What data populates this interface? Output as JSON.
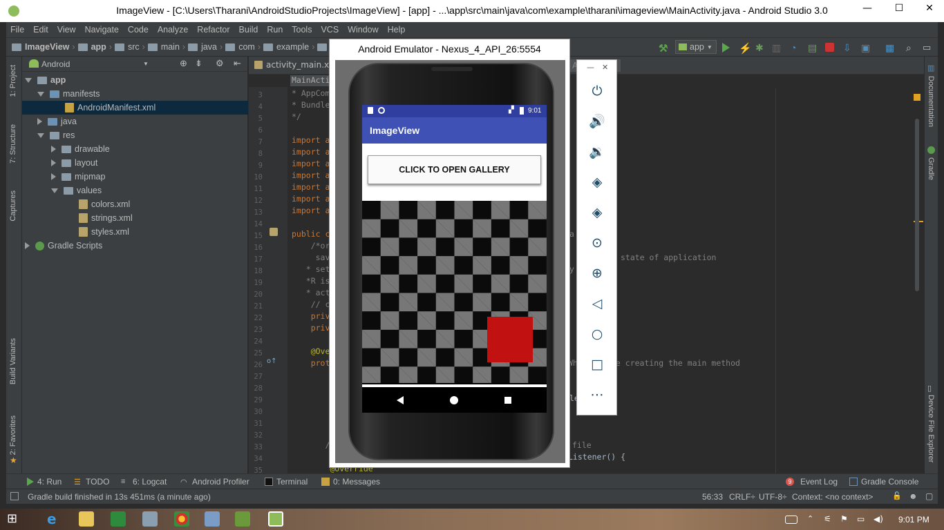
{
  "window": {
    "title": "ImageView - [C:\\Users\\Tharani\\AndroidStudioProjects\\ImageView] - [app] - ...\\app\\src\\main\\java\\com\\example\\tharani\\imageview\\MainActivity.java - Android Studio 3.0",
    "minimize": "—",
    "maximize": "☐",
    "close": "✕"
  },
  "menu": [
    "File",
    "Edit",
    "View",
    "Navigate",
    "Code",
    "Analyze",
    "Refactor",
    "Build",
    "Run",
    "Tools",
    "VCS",
    "Window",
    "Help"
  ],
  "breadcrumb": [
    "ImageView",
    "app",
    "src",
    "main",
    "java",
    "com",
    "example"
  ],
  "toolbar": {
    "config": "app"
  },
  "project": {
    "view": "Android",
    "tree": [
      {
        "label": "app",
        "bold": true
      },
      {
        "label": "manifests"
      },
      {
        "label": "AndroidManifest.xml"
      },
      {
        "label": "java"
      },
      {
        "label": "res"
      },
      {
        "label": "drawable"
      },
      {
        "label": "layout"
      },
      {
        "label": "mipmap"
      },
      {
        "label": "values"
      },
      {
        "label": "colors.xml"
      },
      {
        "label": "strings.xml"
      },
      {
        "label": "styles.xml"
      },
      {
        "label": "Gradle Scripts"
      }
    ]
  },
  "left_tools": [
    "1: Project",
    "7: Structure",
    "Captures",
    "Build Variants",
    "2: Favorites"
  ],
  "right_tools": [
    "Documentation",
    "Gradle",
    "Device File Explorer"
  ],
  "editor": {
    "tabs": [
      "activity_main.xml"
    ],
    "breadcrumb_chip": "MainActi",
    "lines": [
      "3",
      "4",
      "5",
      "6",
      "7",
      "8",
      "9",
      "10",
      "11",
      "12",
      "13",
      "14",
      "15",
      "16",
      "17",
      "18",
      "19",
      "20",
      "21",
      "22",
      "23",
      "24",
      "25",
      "26",
      "27",
      "28",
      "29",
      "30",
      "31",
      "32",
      "33",
      "34",
      "35"
    ],
    "code": {
      "l3": "* AppCom",
      "l4": "* Bundle",
      "l5": "*/",
      "l7": "import a",
      "l8": "import a",
      "l9": "import a",
      "l10": "import a",
      "l11": "import a",
      "l12": "import a",
      "l13": "import a",
      "l15": "public c",
      "l16": "    /*or",
      "l17": "     sav",
      "l18": "   * set",
      "l19": "   *R is",
      "l20": "   * act",
      "l21": "    // c",
      "l22": "    priv",
      "l23": "    priv",
      "l25": "    @Ove",
      "l26": "    prot",
      "l33": "       /",
      "l35": "        @Override",
      "r15": "a",
      "r17": "state of application",
      "r18": "y",
      "r26a": "Wh",
      "r26b": "re creating the main method",
      "r29": "le",
      "r33": "file",
      "r34": "Listener() {"
    }
  },
  "emulator": {
    "title": "Android Emulator - Nexus_4_API_26:5554",
    "clock": "9:01",
    "app_title": "ImageView",
    "button": "CLICK TO OPEN GALLERY",
    "minimize": "—",
    "close": "✕"
  },
  "bottom_tools": {
    "run": "4: Run",
    "todo": "TODO",
    "logcat": "6: Logcat",
    "profiler": "Android Profiler",
    "terminal": "Terminal",
    "messages": "0: Messages",
    "event_log": "Event Log",
    "event_count": "9",
    "gradle_console": "Gradle Console"
  },
  "status": {
    "message": "Gradle build finished in 13s 451ms (a minute ago)",
    "position": "56:33",
    "line_sep": "CRLF÷",
    "encoding": "UTF-8÷",
    "context": "Context: <no context>"
  },
  "taskbar": {
    "time": "9:01 PM"
  },
  "colors": {
    "accent": "#3f51b5",
    "status_bar": "#303f9f",
    "red_square": "#c21111"
  }
}
